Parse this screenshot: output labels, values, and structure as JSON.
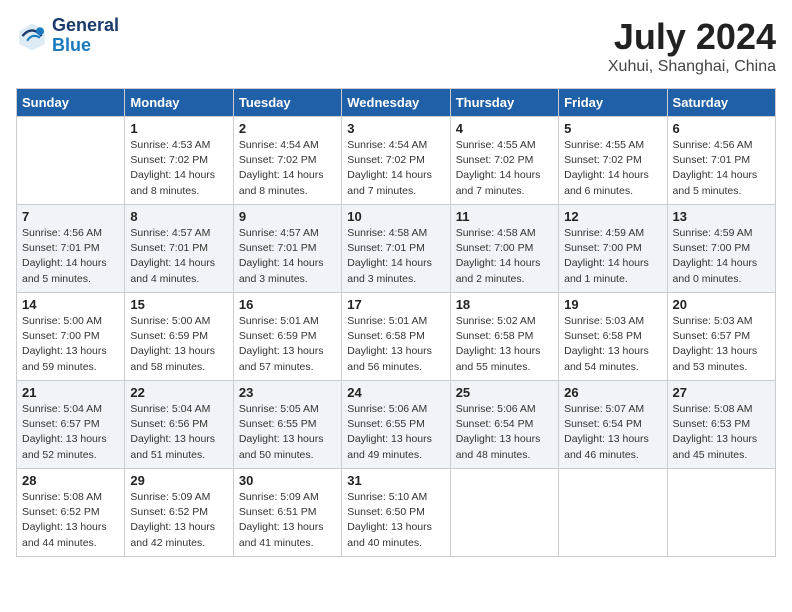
{
  "header": {
    "logo_line1": "General",
    "logo_line2": "Blue",
    "month": "July 2024",
    "location": "Xuhui, Shanghai, China"
  },
  "columns": [
    "Sunday",
    "Monday",
    "Tuesday",
    "Wednesday",
    "Thursday",
    "Friday",
    "Saturday"
  ],
  "weeks": [
    [
      {
        "day": "",
        "text": ""
      },
      {
        "day": "1",
        "text": "Sunrise: 4:53 AM\nSunset: 7:02 PM\nDaylight: 14 hours\nand 8 minutes."
      },
      {
        "day": "2",
        "text": "Sunrise: 4:54 AM\nSunset: 7:02 PM\nDaylight: 14 hours\nand 8 minutes."
      },
      {
        "day": "3",
        "text": "Sunrise: 4:54 AM\nSunset: 7:02 PM\nDaylight: 14 hours\nand 7 minutes."
      },
      {
        "day": "4",
        "text": "Sunrise: 4:55 AM\nSunset: 7:02 PM\nDaylight: 14 hours\nand 7 minutes."
      },
      {
        "day": "5",
        "text": "Sunrise: 4:55 AM\nSunset: 7:02 PM\nDaylight: 14 hours\nand 6 minutes."
      },
      {
        "day": "6",
        "text": "Sunrise: 4:56 AM\nSunset: 7:01 PM\nDaylight: 14 hours\nand 5 minutes."
      }
    ],
    [
      {
        "day": "7",
        "text": "Sunrise: 4:56 AM\nSunset: 7:01 PM\nDaylight: 14 hours\nand 5 minutes."
      },
      {
        "day": "8",
        "text": "Sunrise: 4:57 AM\nSunset: 7:01 PM\nDaylight: 14 hours\nand 4 minutes."
      },
      {
        "day": "9",
        "text": "Sunrise: 4:57 AM\nSunset: 7:01 PM\nDaylight: 14 hours\nand 3 minutes."
      },
      {
        "day": "10",
        "text": "Sunrise: 4:58 AM\nSunset: 7:01 PM\nDaylight: 14 hours\nand 3 minutes."
      },
      {
        "day": "11",
        "text": "Sunrise: 4:58 AM\nSunset: 7:00 PM\nDaylight: 14 hours\nand 2 minutes."
      },
      {
        "day": "12",
        "text": "Sunrise: 4:59 AM\nSunset: 7:00 PM\nDaylight: 14 hours\nand 1 minute."
      },
      {
        "day": "13",
        "text": "Sunrise: 4:59 AM\nSunset: 7:00 PM\nDaylight: 14 hours\nand 0 minutes."
      }
    ],
    [
      {
        "day": "14",
        "text": "Sunrise: 5:00 AM\nSunset: 7:00 PM\nDaylight: 13 hours\nand 59 minutes."
      },
      {
        "day": "15",
        "text": "Sunrise: 5:00 AM\nSunset: 6:59 PM\nDaylight: 13 hours\nand 58 minutes."
      },
      {
        "day": "16",
        "text": "Sunrise: 5:01 AM\nSunset: 6:59 PM\nDaylight: 13 hours\nand 57 minutes."
      },
      {
        "day": "17",
        "text": "Sunrise: 5:01 AM\nSunset: 6:58 PM\nDaylight: 13 hours\nand 56 minutes."
      },
      {
        "day": "18",
        "text": "Sunrise: 5:02 AM\nSunset: 6:58 PM\nDaylight: 13 hours\nand 55 minutes."
      },
      {
        "day": "19",
        "text": "Sunrise: 5:03 AM\nSunset: 6:58 PM\nDaylight: 13 hours\nand 54 minutes."
      },
      {
        "day": "20",
        "text": "Sunrise: 5:03 AM\nSunset: 6:57 PM\nDaylight: 13 hours\nand 53 minutes."
      }
    ],
    [
      {
        "day": "21",
        "text": "Sunrise: 5:04 AM\nSunset: 6:57 PM\nDaylight: 13 hours\nand 52 minutes."
      },
      {
        "day": "22",
        "text": "Sunrise: 5:04 AM\nSunset: 6:56 PM\nDaylight: 13 hours\nand 51 minutes."
      },
      {
        "day": "23",
        "text": "Sunrise: 5:05 AM\nSunset: 6:55 PM\nDaylight: 13 hours\nand 50 minutes."
      },
      {
        "day": "24",
        "text": "Sunrise: 5:06 AM\nSunset: 6:55 PM\nDaylight: 13 hours\nand 49 minutes."
      },
      {
        "day": "25",
        "text": "Sunrise: 5:06 AM\nSunset: 6:54 PM\nDaylight: 13 hours\nand 48 minutes."
      },
      {
        "day": "26",
        "text": "Sunrise: 5:07 AM\nSunset: 6:54 PM\nDaylight: 13 hours\nand 46 minutes."
      },
      {
        "day": "27",
        "text": "Sunrise: 5:08 AM\nSunset: 6:53 PM\nDaylight: 13 hours\nand 45 minutes."
      }
    ],
    [
      {
        "day": "28",
        "text": "Sunrise: 5:08 AM\nSunset: 6:52 PM\nDaylight: 13 hours\nand 44 minutes."
      },
      {
        "day": "29",
        "text": "Sunrise: 5:09 AM\nSunset: 6:52 PM\nDaylight: 13 hours\nand 42 minutes."
      },
      {
        "day": "30",
        "text": "Sunrise: 5:09 AM\nSunset: 6:51 PM\nDaylight: 13 hours\nand 41 minutes."
      },
      {
        "day": "31",
        "text": "Sunrise: 5:10 AM\nSunset: 6:50 PM\nDaylight: 13 hours\nand 40 minutes."
      },
      {
        "day": "",
        "text": ""
      },
      {
        "day": "",
        "text": ""
      },
      {
        "day": "",
        "text": ""
      }
    ]
  ]
}
